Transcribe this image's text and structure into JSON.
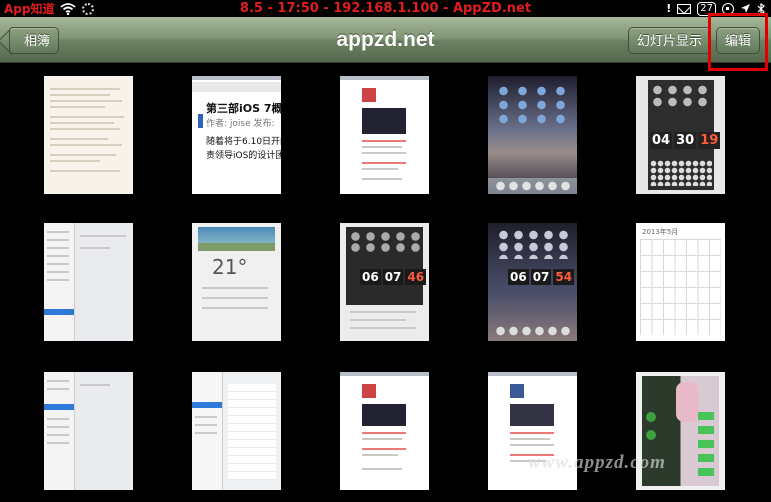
{
  "status_bar": {
    "app_name": "App知道",
    "center_text": "8.5 - 17:50 - 192.168.1.100 - AppZD.net",
    "calendar_badge": "27"
  },
  "nav_bar": {
    "title": "appzd.net",
    "back_label": "相簿",
    "slideshow_label": "幻灯片显示",
    "edit_label": "编辑"
  },
  "photos": [
    {
      "kind": "document"
    },
    {
      "kind": "article",
      "heading": "第三部iOS 7概:",
      "meta": "作者: joise   发布:",
      "body1": "随着将于6.10日开的V",
      "body2": "责领导iOS的设计团队"
    },
    {
      "kind": "webpage"
    },
    {
      "kind": "homescreen"
    },
    {
      "kind": "clock",
      "clock": [
        "04",
        "30",
        "19"
      ]
    },
    {
      "kind": "settings"
    },
    {
      "kind": "weather",
      "temp": "21°"
    },
    {
      "kind": "clock",
      "clock": [
        "06",
        "07",
        "46"
      ]
    },
    {
      "kind": "clock",
      "clock": [
        "06",
        "07",
        "54"
      ]
    },
    {
      "kind": "calendar",
      "title": "2013年5月"
    },
    {
      "kind": "settings"
    },
    {
      "kind": "settings"
    },
    {
      "kind": "webpage"
    },
    {
      "kind": "webpage"
    },
    {
      "kind": "contacts"
    }
  ],
  "watermark": "www.appzd.com",
  "colors": {
    "navbar_top": "#a6b79a",
    "navbar_bottom": "#56694e",
    "status_red": "#e21d1d",
    "highlight": "#e10000"
  }
}
